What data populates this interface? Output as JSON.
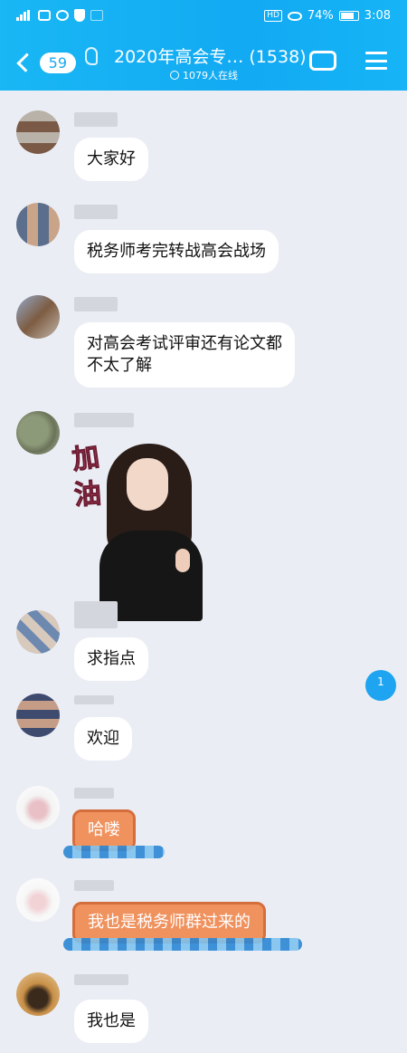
{
  "status_bar": {
    "battery": "74%",
    "time": "3:08",
    "hd": "HD"
  },
  "header": {
    "back_count": "59",
    "title": "2020年高会专… (1538)",
    "online": "1079人在线"
  },
  "messages": [
    {
      "text": "大家好"
    },
    {
      "text": "税务师考完转战高会战场"
    },
    {
      "text_line1": "对高会考试评审还有论文都",
      "text_line2": "不太了解"
    },
    {
      "sticker_line1": "加",
      "sticker_line2": "油"
    },
    {
      "text": "求指点"
    },
    {
      "text": "欢迎"
    },
    {
      "text": "哈喽"
    },
    {
      "text": "我也是税务师群过来的"
    },
    {
      "text": "我也是"
    }
  ],
  "float_badge": "1",
  "colors": {
    "header_bg": "#14aef3",
    "chat_bg": "#eaedf4",
    "bubble_bg": "#ffffff",
    "fancy_bubble": "#f0925e",
    "badge": "#1ea4f0"
  }
}
